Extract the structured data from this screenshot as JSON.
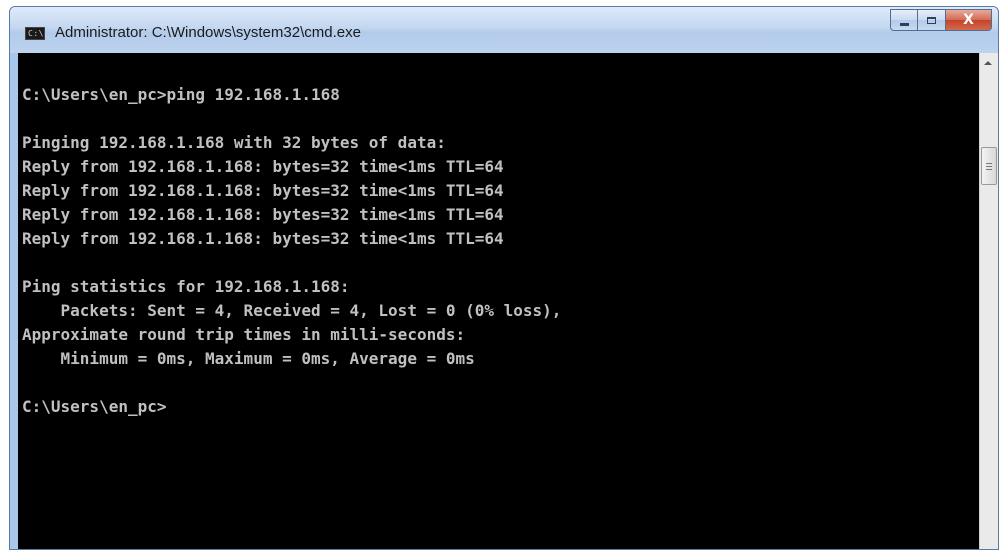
{
  "window": {
    "title": "Administrator: C:\\Windows\\system32\\cmd.exe",
    "icon_label": "C:\\",
    "buttons": {
      "close_glyph": "X"
    }
  },
  "console": {
    "lines": [
      "",
      "C:\\Users\\en_pc>ping 192.168.1.168",
      "",
      "Pinging 192.168.1.168 with 32 bytes of data:",
      "Reply from 192.168.1.168: bytes=32 time<1ms TTL=64",
      "Reply from 192.168.1.168: bytes=32 time<1ms TTL=64",
      "Reply from 192.168.1.168: bytes=32 time<1ms TTL=64",
      "Reply from 192.168.1.168: bytes=32 time<1ms TTL=64",
      "",
      "Ping statistics for 192.168.1.168:",
      "    Packets: Sent = 4, Received = 4, Lost = 0 (0% loss),",
      "Approximate round trip times in milli-seconds:",
      "    Minimum = 0ms, Maximum = 0ms, Average = 0ms",
      "",
      "C:\\Users\\en_pc>"
    ]
  },
  "colors": {
    "console_bg": "#000000",
    "console_fg": "#c0c0c0",
    "titlebar": "#bcd2ee",
    "close_button": "#c2452c"
  },
  "icons": {
    "window_icon": "cmd-console-icon",
    "minimize": "minimize-icon",
    "maximize": "maximize-icon",
    "close": "close-icon",
    "scroll_up": "chevron-up-icon"
  }
}
